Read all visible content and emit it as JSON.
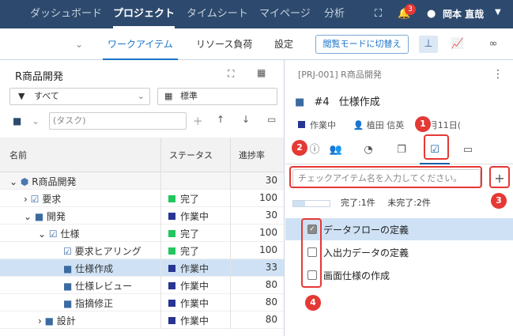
{
  "topnav": {
    "items": [
      "ダッシュボード",
      "プロジェクト",
      "タイムシート",
      "マイページ",
      "分析"
    ],
    "badge": "3",
    "user": "岡本 直哉"
  },
  "subnav": {
    "tabs": [
      "ワークアイテム",
      "リソース負荷",
      "設定"
    ],
    "read_mode": "閲覧モードに切替え"
  },
  "left": {
    "title": "R商品開発",
    "filter": "すべて",
    "view": "標準",
    "task_placeholder": "(タスク)",
    "columns": [
      "名前",
      "ステータス",
      "進捗率"
    ],
    "rows": [
      {
        "name": "R商品開発",
        "status": "",
        "progress": "30"
      },
      {
        "name": "要求",
        "status": "完了",
        "progress": "100"
      },
      {
        "name": "開発",
        "status": "作業中",
        "progress": "30"
      },
      {
        "name": "仕様",
        "status": "完了",
        "progress": "100"
      },
      {
        "name": "要求ヒアリング",
        "status": "完了",
        "progress": "100"
      },
      {
        "name": "仕様作成",
        "status": "作業中",
        "progress": "33"
      },
      {
        "name": "仕様レビュー",
        "status": "作業中",
        "progress": "80"
      },
      {
        "name": "指摘修正",
        "status": "作業中",
        "progress": "80"
      },
      {
        "name": "設計",
        "status": "作業中",
        "progress": "80"
      }
    ]
  },
  "right": {
    "project": "[PRJ-001] R商品開発",
    "item_no": "#4",
    "item_title": "仕様作成",
    "status": "作業中",
    "assignee": "植田 信英",
    "date": "10月11日(",
    "input_placeholder": "チェックアイテム名を入力してください。",
    "done_label": "完了:1件",
    "undone_label": "未完了:2件",
    "done_ratio": 0.33,
    "checklist": [
      {
        "label": "データフローの定義",
        "checked": true
      },
      {
        "label": "入出力データの定義",
        "checked": false
      },
      {
        "label": "画面仕様の作成",
        "checked": false
      }
    ]
  },
  "callouts": [
    "1",
    "2",
    "3",
    "4"
  ],
  "colors": {
    "done": "#22c55e",
    "working": "#283593",
    "nav": "#2d4a6e",
    "accent": "#1a73c8",
    "callout": "#e53935"
  }
}
